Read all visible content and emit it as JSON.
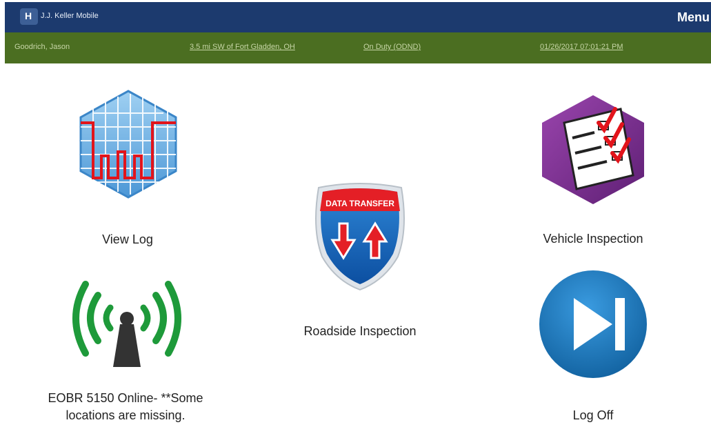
{
  "header": {
    "logo_letter": "H",
    "app_title": "J.J. Keller Mobile",
    "menu_label": "Menu"
  },
  "status": {
    "driver": "Goodrich, Jason",
    "location": "3.5 mi SW of Fort Gladden, OH",
    "duty_status": "On Duty (ODND)",
    "datetime": "01/26/2017 07:01:21 PM"
  },
  "tiles": {
    "view_log": {
      "label": "View Log",
      "icon": "log-grid-icon"
    },
    "roadside": {
      "label": "Roadside Inspection",
      "icon": "data-transfer-shield-icon",
      "badge": "DATA TRANSFER"
    },
    "vehicle": {
      "label": "Vehicle Inspection",
      "icon": "checklist-icon"
    },
    "eobr": {
      "label_line1": "EOBR 5150 Online- **Some",
      "label_line2": "locations are missing.",
      "icon": "signal-tower-icon"
    },
    "log_off": {
      "label": "Log Off",
      "icon": "skip-forward-icon"
    }
  },
  "colors": {
    "header_bg": "#1c3a6e",
    "status_bg": "#4b6e21",
    "grid_blue": "#5aa4dd",
    "log_red": "#e2141b",
    "signal_green": "#1e9a3a",
    "purple": "#7b2f8f",
    "logoff_blue": "#1b79c4"
  }
}
